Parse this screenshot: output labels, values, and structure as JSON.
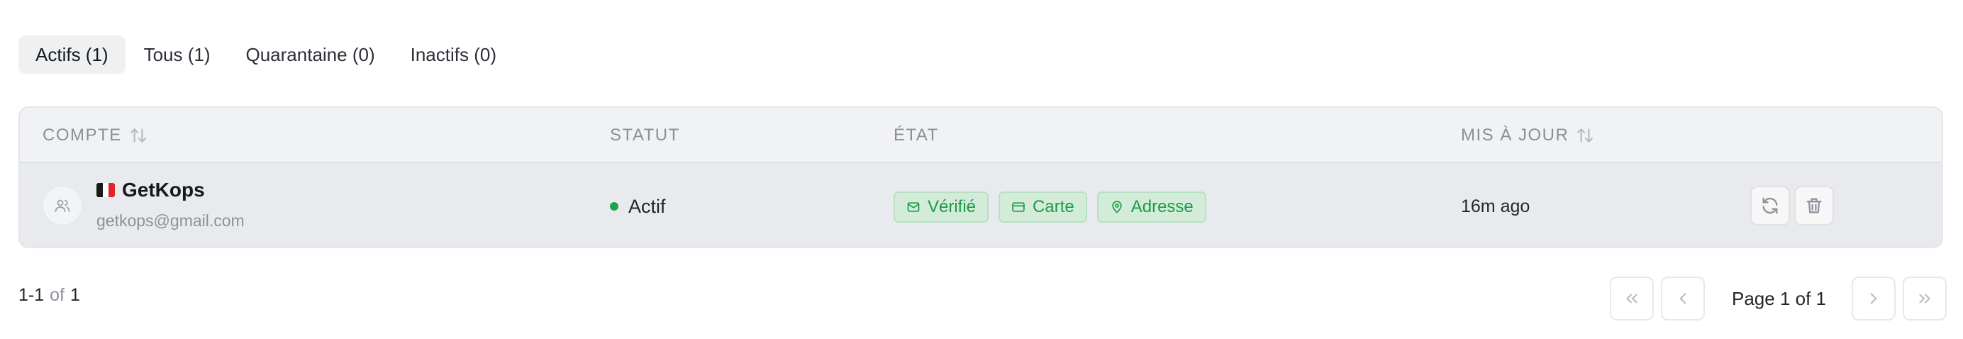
{
  "tabs": [
    {
      "label": "Actifs (1)",
      "active": true
    },
    {
      "label": "Tous (1)",
      "active": false
    },
    {
      "label": "Quarantaine (0)",
      "active": false
    },
    {
      "label": "Inactifs (0)",
      "active": false
    }
  ],
  "table": {
    "headers": {
      "account": "COMPTE",
      "status": "STATUT",
      "state": "ÉTAT",
      "updated": "MIS À JOUR"
    },
    "rows": [
      {
        "flag_colors": [
          "#1a1a1a",
          "#ffffff",
          "#e0242b"
        ],
        "name": "GetKops",
        "email": "getkops@gmail.com",
        "status": "Actif",
        "status_color": "#20a348",
        "badges": [
          {
            "label": "Vérifié",
            "icon": "mail-icon"
          },
          {
            "label": "Carte",
            "icon": "card-icon"
          },
          {
            "label": "Adresse",
            "icon": "map-pin-icon"
          }
        ],
        "updated": "16m ago",
        "actions": [
          "refresh-icon",
          "trash-icon"
        ]
      }
    ]
  },
  "footer": {
    "range": "1-1",
    "of_word": "of",
    "total": "1",
    "page_label": "Page 1 of 1"
  },
  "colors": {
    "accent_green": "#1b9a45",
    "badge_bg": "#d3ecda",
    "badge_border": "#b8e0c3",
    "row_bg": "#e9eaed",
    "header_bg": "#f1f2f4"
  }
}
